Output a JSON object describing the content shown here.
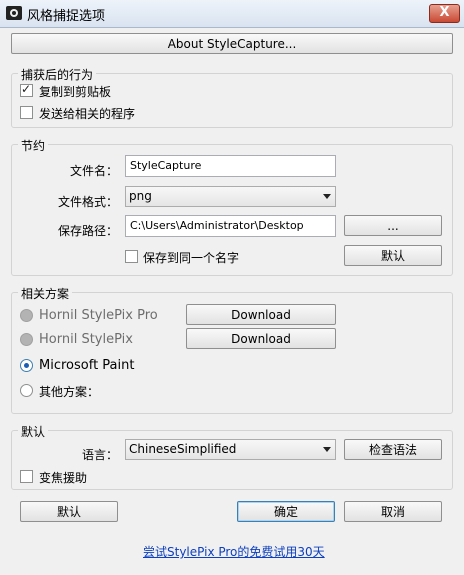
{
  "window": {
    "title": "风格捕捉选项",
    "close_label": "X"
  },
  "about_button": "About StyleCapture...",
  "capture_group": {
    "legend": "捕获后的行为",
    "copy_clipboard": {
      "label": "复制到剪贴板",
      "checked": true
    },
    "send_program": {
      "label": "发送给相关的程序",
      "checked": false
    }
  },
  "save_group": {
    "legend": "节约",
    "filename_label": "文件名：",
    "filename_value": "StyleCapture",
    "format_label": "文件格式：",
    "format_value": "png",
    "path_label": "保存路径：",
    "path_value": "C:\\Users\\Administrator\\Desktop",
    "browse_label": "...",
    "same_name": {
      "label": "保存到同一个名字",
      "checked": false
    },
    "default_label": "默认"
  },
  "program_group": {
    "legend": "相关方案",
    "options": [
      {
        "label": "Hornil StylePix Pro",
        "state": "disabled"
      },
      {
        "label": "Hornil StylePix",
        "state": "disabled"
      },
      {
        "label": "Microsoft Paint",
        "state": "checked"
      },
      {
        "label": "其他方案：",
        "state": "unchecked"
      }
    ],
    "download1": "Download",
    "download2": "Download"
  },
  "default_group": {
    "legend": "默认",
    "language_label": "语言：",
    "language_value": "ChineseSimplified",
    "check_grammar": "检查语法",
    "zoom_assist": {
      "label": "变焦援助",
      "checked": false
    }
  },
  "footer": {
    "default_label": "默认",
    "ok_label": "确定",
    "cancel_label": "取消",
    "trial_link": "尝试StylePix Pro的免费试用30天"
  },
  "colors": {
    "link": "#0c3fbf",
    "close": "#c94a34",
    "focus": "#3c7fb1"
  }
}
